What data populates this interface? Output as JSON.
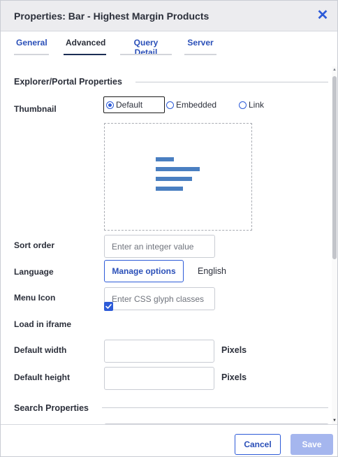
{
  "dialog": {
    "title": "Properties: Bar - Highest Margin Products",
    "close_icon": "close-icon"
  },
  "tabs": [
    {
      "label": "General",
      "active": false
    },
    {
      "label": "Advanced",
      "active": true
    },
    {
      "label": "Query Detail",
      "active": false
    },
    {
      "label": "Server",
      "active": false
    }
  ],
  "sections": {
    "explorer_title": "Explorer/Portal Properties",
    "search_title": "Search Properties"
  },
  "thumbnail": {
    "label": "Thumbnail",
    "options": [
      "Default",
      "Embedded",
      "Link"
    ],
    "selected": "Default",
    "preview_icon": "bar-chart-icon"
  },
  "sort_order": {
    "label": "Sort order",
    "placeholder": "Enter an integer value",
    "value": ""
  },
  "language": {
    "label": "Language",
    "button_label": "Manage options",
    "value": "English"
  },
  "menu_icon": {
    "label": "Menu Icon",
    "placeholder": "Enter CSS glyph classes",
    "value": ""
  },
  "load_in_iframe": {
    "label": "Load in iframe",
    "checked": true
  },
  "default_width": {
    "label": "Default width",
    "value": "",
    "unit": "Pixels"
  },
  "default_height": {
    "label": "Default height",
    "value": "",
    "unit": "Pixels"
  },
  "footer": {
    "cancel_label": "Cancel",
    "save_label": "Save"
  },
  "colors": {
    "accent": "#2d5bd8",
    "save_disabled": "#a5b6ee",
    "thumbnail_bars": "#4a7fc1"
  }
}
